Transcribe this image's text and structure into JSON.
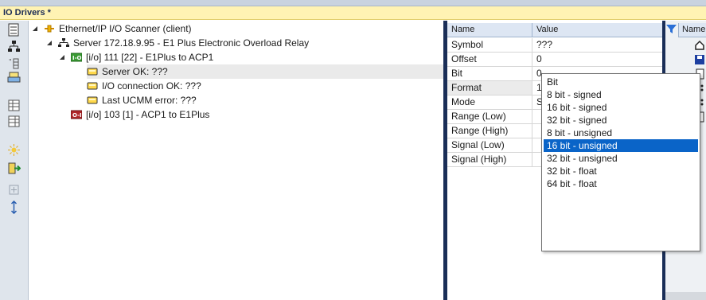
{
  "panel_title": "IO Drivers *",
  "toolbar_icons": [
    "tree-view-icon",
    "network-icon",
    "columns-icon",
    "printer-icon",
    "grid-icon",
    "grid-icon-2",
    "sparkle-icon",
    "export-icon",
    "add-icon",
    "move-icon"
  ],
  "tree": [
    {
      "label": "Ethernet/IP I/O Scanner (client)",
      "icon": "driver-icon",
      "expanded": true
    },
    {
      "label": "Server 172.18.9.95 - E1 Plus Electronic Overload Relay",
      "icon": "server-icon",
      "expanded": true
    },
    {
      "label": "[i/o] 111 [22] - E1Plus to ACP1",
      "icon": "io-input-icon",
      "expanded": true
    },
    {
      "label": "Server OK: ???",
      "icon": "tag-icon"
    },
    {
      "label": "I/O connection OK: ???",
      "icon": "tag-icon"
    },
    {
      "label": "Last UCMM error: ???",
      "icon": "tag-icon"
    },
    {
      "label": "[i/o] 103 [1] - ACP1 to E1Plus",
      "icon": "io-output-icon"
    }
  ],
  "properties": {
    "header": {
      "name": "Name",
      "value": "Value"
    },
    "rows": [
      {
        "name": "Symbol",
        "value": "???"
      },
      {
        "name": "Offset",
        "value": "0"
      },
      {
        "name": "Bit",
        "value": "0"
      },
      {
        "name": "Format",
        "value": "1"
      },
      {
        "name": "Mode",
        "value": "S"
      },
      {
        "name": "Range (Low)",
        "value": ""
      },
      {
        "name": "Range (High)",
        "value": ""
      },
      {
        "name": "Signal (Low)",
        "value": ""
      },
      {
        "name": "Signal (High)",
        "value": ""
      }
    ]
  },
  "format_dropdown": {
    "options": [
      "Bit",
      "8 bit - signed",
      "16 bit - signed",
      "32 bit - signed",
      "8 bit - unsigned",
      "16 bit - unsigned",
      "32 bit - unsigned",
      "32 bit - float",
      "64 bit - float"
    ],
    "highlighted": "16 bit - unsigned"
  },
  "right_panel": {
    "header": "Name",
    "icons": [
      "home-icon",
      "save-icon",
      "document-icon",
      "dots-icon",
      "dots-icon-2",
      "document-icon-2"
    ]
  },
  "colors": {
    "title_bg": "#fff3b3",
    "splitter": "#1a2e57",
    "highlight": "#0a64c8",
    "toolbar_bg": "#dfe5ec"
  }
}
